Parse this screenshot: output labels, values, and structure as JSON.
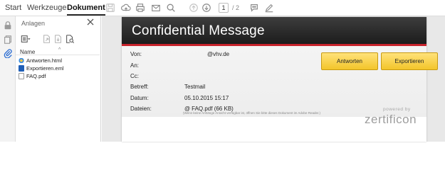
{
  "tabs": [
    "Start",
    "Werkzeuge",
    "Dokument"
  ],
  "active_tab": "Dokument",
  "toolbar": {
    "page_current": "1",
    "page_total": "/ 2",
    "icons": [
      "save-icon",
      "cloud-upload-icon",
      "print-icon",
      "mail-icon",
      "search-icon",
      "page-up-icon",
      "page-down-icon",
      "comment-icon",
      "pen-icon"
    ]
  },
  "leftbar": {
    "icons": [
      "lock-icon",
      "copy-icon",
      "paperclip-icon"
    ]
  },
  "panel": {
    "title": "Anlagen",
    "column_name": "Name",
    "files": [
      {
        "name": "Antworten.html",
        "type": "html"
      },
      {
        "name": "Exportieren.eml",
        "type": "eml"
      },
      {
        "name": "FAQ.pdf",
        "type": "pdf"
      }
    ]
  },
  "message": {
    "banner_title": "Confidential Message",
    "labels": {
      "from": "Von:",
      "to": "An:",
      "cc": "Cc:",
      "subject": "Betreff:",
      "date": "Datum:",
      "files": "Dateien:"
    },
    "values": {
      "from": "@vhv.de",
      "to": "",
      "cc": "",
      "subject": "Testmail",
      "date": "05.10.2015 15:17",
      "files": "FAQ.pdf (66 KB)"
    },
    "note": "(Wenn keine Anhänge Ansicht verfügbar ist, öffnen Sie bitte dieses Dokument im Adobe Reader.)",
    "buttons": {
      "reply": "Antworten",
      "export": "Exportieren"
    },
    "powered_by": "powered by",
    "brand": "zertificon"
  },
  "colors": {
    "banner": "#222222",
    "stripe": "#c8232c",
    "button": "#f3c52a",
    "active_icon": "#2e6fd3"
  }
}
